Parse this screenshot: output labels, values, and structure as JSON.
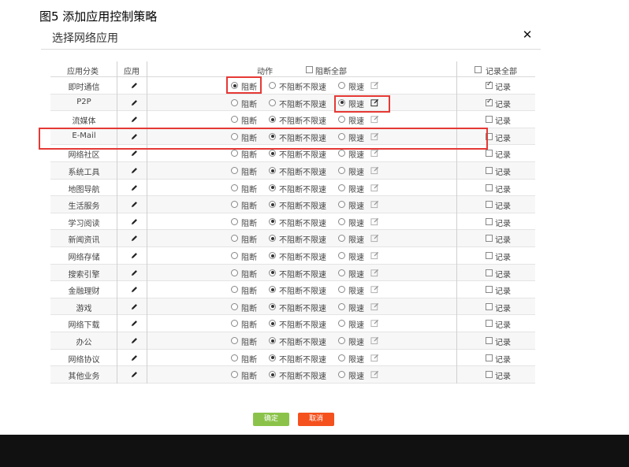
{
  "figure_title": "图5 添加应用控制策略",
  "dialog": {
    "title": "选择网络应用",
    "close_glyph": "✕"
  },
  "header": {
    "category": "应用分类",
    "app": "应用",
    "action": "动作",
    "block_all": "阻断全部",
    "log_all": "记录全部"
  },
  "labels": {
    "block": "阻断",
    "no_block": "不阻断不限速",
    "limit": "限速",
    "log": "记录"
  },
  "rows": [
    {
      "category": "即时通信",
      "action": "block",
      "log": true
    },
    {
      "category": "P2P",
      "action": "limit",
      "log": true
    },
    {
      "category": "流媒体",
      "action": "no_block",
      "log": false
    },
    {
      "category": "E-Mail",
      "action": "no_block",
      "log": false
    },
    {
      "category": "网络社区",
      "action": "no_block",
      "log": false
    },
    {
      "category": "系统工具",
      "action": "no_block",
      "log": false
    },
    {
      "category": "地图导航",
      "action": "no_block",
      "log": false
    },
    {
      "category": "生活服务",
      "action": "no_block",
      "log": false
    },
    {
      "category": "学习阅读",
      "action": "no_block",
      "log": false
    },
    {
      "category": "新闻资讯",
      "action": "no_block",
      "log": false
    },
    {
      "category": "网络存储",
      "action": "no_block",
      "log": false
    },
    {
      "category": "搜索引擎",
      "action": "no_block",
      "log": false
    },
    {
      "category": "金融理财",
      "action": "no_block",
      "log": false
    },
    {
      "category": "游戏",
      "action": "no_block",
      "log": false
    },
    {
      "category": "网络下载",
      "action": "no_block",
      "log": false
    },
    {
      "category": "办公",
      "action": "no_block",
      "log": false
    },
    {
      "category": "网络协议",
      "action": "no_block",
      "log": false
    },
    {
      "category": "其他业务",
      "action": "no_block",
      "log": false
    }
  ],
  "buttons": {
    "confirm": "确定",
    "cancel": "取消"
  },
  "colors": {
    "confirm": "#8bc34a",
    "cancel": "#f4511e",
    "highlight": "#e53935"
  }
}
